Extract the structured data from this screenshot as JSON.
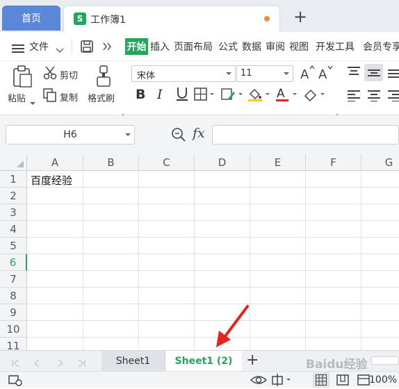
{
  "tabs": {
    "home": "首页",
    "workbook_logo": "S",
    "workbook": "工作簿1",
    "new_tab": "+"
  },
  "menu": {
    "file": "文件",
    "items": [
      "开始",
      "插入",
      "页面布局",
      "公式",
      "数据",
      "审阅",
      "视图",
      "开发工具",
      "会员专享"
    ]
  },
  "ribbon": {
    "paste": "粘贴",
    "cut": "剪切",
    "copy": "复制",
    "format_painter": "格式刷",
    "font_name": "宋体",
    "font_size": "11"
  },
  "formula_bar": {
    "cell_ref": "H6",
    "fx": "fx",
    "content": ""
  },
  "grid": {
    "columns": [
      "A",
      "B",
      "C",
      "D",
      "E",
      "F",
      "G"
    ],
    "rows": [
      "1",
      "2",
      "3",
      "4",
      "5",
      "6",
      "7",
      "8",
      "9",
      "10",
      "11"
    ],
    "active_row": "6",
    "cell_A1": "百度经验"
  },
  "sheets": {
    "tab1": "Sheet1",
    "tab2": "Sheet1 (2)",
    "add": "+"
  },
  "status": {
    "zoom": "100%"
  },
  "watermark": "Baidu经验",
  "colors": {
    "accent_green": "#23a55c",
    "home_tab_blue": "#5b87d9",
    "arrow_red": "#e8231b"
  }
}
